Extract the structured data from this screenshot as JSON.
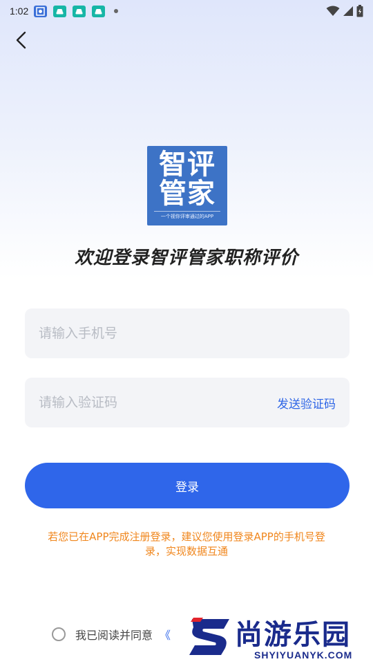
{
  "status_bar": {
    "time": "1:02",
    "icons": [
      "photo-app-icon",
      "car-app-icon",
      "car-app-icon",
      "car-app-icon",
      "more-dot-icon"
    ],
    "right_icons": [
      "wifi-icon",
      "signal-icon",
      "battery-icon"
    ]
  },
  "nav": {
    "back_icon": "chevron-left-icon"
  },
  "logo": {
    "line1": "智评",
    "line2": "管家",
    "tagline": "一个视你评审通过的APP",
    "background_color": "#3d73c6"
  },
  "welcome_title": "欢迎登录智评管家职称评价",
  "phone_field": {
    "value": "",
    "placeholder": "请输入手机号"
  },
  "code_field": {
    "value": "",
    "placeholder": "请输入验证码",
    "send_label": "发送验证码"
  },
  "login_button": {
    "label": "登录",
    "color": "#2f66ea"
  },
  "notice": {
    "text": "若您已在APP完成注册登录，建议您使用登录APP的手机号登录，实现数据互通",
    "color": "#f0861c"
  },
  "agreement": {
    "checked": false,
    "text": "我已阅读并同意",
    "link_text": "《"
  },
  "watermark": {
    "title": "尚游乐园",
    "url": "SHYIYUANYK.COM"
  }
}
